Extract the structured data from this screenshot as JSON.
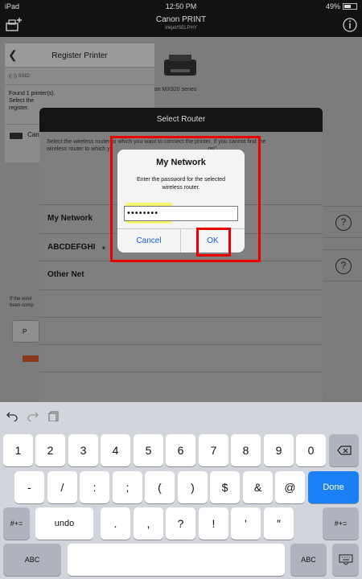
{
  "status": {
    "device": "iPad",
    "time": "12:50 PM",
    "battery": "49%"
  },
  "app": {
    "title": "Canon PRINT",
    "subtitle": "Inkjet/SELPHY"
  },
  "background": {
    "printer_label": "anon MX920 series",
    "register_panel": {
      "title": "Register Printer",
      "ssid_label": "SSID:",
      "found_line1": "Found 1 printer(s).",
      "found_line2": "Select the",
      "found_line3": "register.",
      "printer_item": "Can"
    },
    "bottom_note_line1": "If the wirel",
    "bottom_note_line2": "been comp",
    "bottom_button": "P"
  },
  "select_router": {
    "title": "Select Router",
    "description_line1": "Select the wireless router to which you want to connect the printer. If you cannot find the",
    "description_line2": "wireless router to which y",
    "description_tail": "on\".",
    "networks": [
      "My Network",
      "ABCDEFGHI",
      "Other Net"
    ],
    "network2_extra": "e"
  },
  "dialog": {
    "title": "My Network",
    "message": "Enter the password for the selected wireless router.",
    "password": "••••••••",
    "cancel": "Cancel",
    "ok": "OK"
  },
  "keyboard": {
    "row1": [
      "1",
      "2",
      "3",
      "4",
      "5",
      "6",
      "7",
      "8",
      "9",
      "0"
    ],
    "row2": [
      "-",
      "/",
      ":",
      ";",
      "(",
      ")",
      "$",
      "&",
      "@"
    ],
    "done": "Done",
    "row3_symbol_toggle": "#+=",
    "undo": "undo",
    "row3": [
      ".",
      ",",
      "?",
      "!",
      "'",
      "″"
    ],
    "abc": "ABC"
  },
  "colors": {
    "accent_blue": "#1d5bd6",
    "done_blue": "#1b80f6",
    "highlight_red": "#ea0000",
    "highlight_yellow": "#f5f542"
  },
  "icons": [
    "add-printer-icon",
    "info-icon",
    "wifi-icon",
    "printer-icon",
    "back-chevron-icon",
    "help-icon",
    "undo-icon",
    "redo-icon",
    "paste-icon",
    "delete-icon",
    "keyboard-hide-icon"
  ]
}
